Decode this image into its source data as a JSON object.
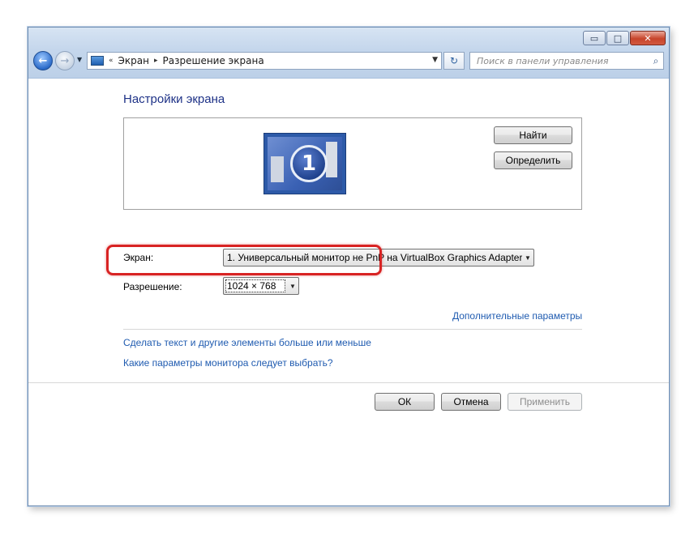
{
  "window": {
    "controls": {
      "minimize": "▭",
      "maximize": "□",
      "close": "✕"
    }
  },
  "nav": {
    "back": "←",
    "forward": "→",
    "history": "▼"
  },
  "address": {
    "double_arrow": "«",
    "parts": [
      "Экран",
      "Разрешение экрана"
    ],
    "separator": "▸",
    "dropdown": "▼"
  },
  "refresh": "↻",
  "search": {
    "placeholder": "Поиск в панели управления",
    "icon": "⌕"
  },
  "page": {
    "title": "Настройки экрана",
    "monitor_number": "1",
    "buttons": {
      "find": "Найти",
      "identify": "Определить"
    },
    "screen_label": "Экран:",
    "screen_value": "1. Универсальный монитор не PnP на VirtualBox Graphics Adapter",
    "resolution_label": "Разрешение:",
    "resolution_value": "1024 × 768",
    "advanced_link": "Дополнительные параметры",
    "links": [
      "Сделать текст и другие элементы больше или меньше",
      "Какие параметры монитора следует выбрать?"
    ],
    "footer_buttons": {
      "ok": "ОК",
      "cancel": "Отмена",
      "apply": "Применить"
    }
  },
  "colors": {
    "title": "#1e3287",
    "link": "#1f5bb0",
    "highlight": "#d82323"
  }
}
